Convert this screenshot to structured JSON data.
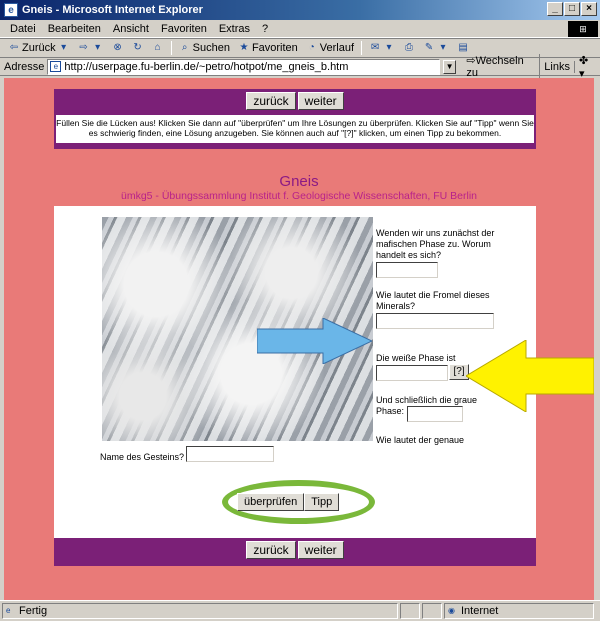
{
  "window": {
    "title": "Gneis - Microsoft Internet Explorer"
  },
  "menu": [
    "Datei",
    "Bearbeiten",
    "Ansicht",
    "Favoriten",
    "Extras",
    "?"
  ],
  "toolbar": {
    "back": "Zurück",
    "search": "Suchen",
    "favorites": "Favoriten",
    "history": "Verlauf"
  },
  "address": {
    "label": "Adresse",
    "url": "http://userpage.fu-berlin.de/~petro/hotpot/me_gneis_b.htm",
    "go": "Wechseln zu",
    "links": "Links"
  },
  "nav": {
    "back": "zurück",
    "next": "weiter"
  },
  "instructions": "Füllen Sie die Lücken aus! Klicken Sie dann auf \"überprüfen\" um Ihre Lösungen zu überprüfen. Klicken Sie auf \"Tipp\" wenn Sie es schwierig finden, eine Lösung anzugeben. Sie können auch auf \"[?]\" klicken, um einen Tipp zu bekommen.",
  "page": {
    "title": "Gneis",
    "subtitle": "ümkg5 - Übungssammlung Institut f. Geologische Wissenschaften, FU Berlin"
  },
  "questions": {
    "q1": "Wenden wir uns zunächst der mafischen Phase zu. Worum handelt es sich?",
    "q2": "Wie lautet die Fromel dieses Minerals?",
    "q3": "Die weiße Phase ist",
    "q4": "Und schließlich die graue Phase:",
    "q5": "Wie lautet der genaue",
    "q6": "Name des Gesteins?"
  },
  "hint_bracket": "[?]",
  "check": {
    "check_label": "überprüfen",
    "tip_label": "Tipp"
  },
  "status": {
    "text": "Fertig",
    "zone": "Internet"
  },
  "colors": {
    "page_bg": "#e97a78",
    "nav_bg": "#7b2077",
    "arrow_blue": "#6ab6e8",
    "arrow_yellow": "#fff200",
    "ring": "#7ab83a"
  }
}
